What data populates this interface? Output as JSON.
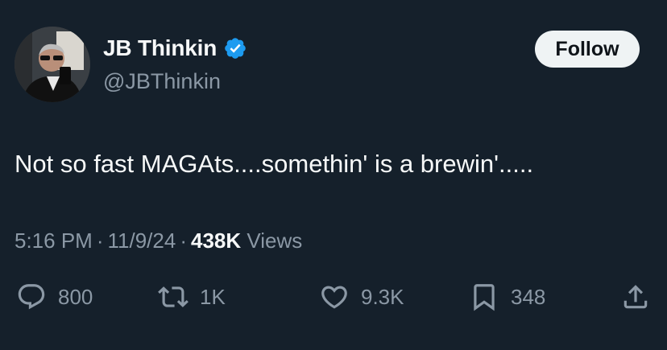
{
  "author": {
    "display_name": "JB Thinkin",
    "handle": "@JBThinkin",
    "verified": true,
    "verified_color": "#1d9bf0"
  },
  "follow_label": "Follow",
  "tweet": {
    "text": "Not so fast MAGAts....somethin' is a brewin'.....",
    "time": "5:16 PM",
    "date": "11/9/24",
    "views_count": "438K",
    "views_label": "Views"
  },
  "actions": {
    "replies": {
      "icon": "reply-icon",
      "count": "800"
    },
    "reposts": {
      "icon": "repost-icon",
      "count": "1K"
    },
    "likes": {
      "icon": "heart-icon",
      "count": "9.3K"
    },
    "bookmarks": {
      "icon": "bookmark-icon",
      "count": "348"
    },
    "share": {
      "icon": "share-icon"
    }
  },
  "colors": {
    "background": "#15202b",
    "text_primary": "#f7f9f9",
    "text_secondary": "#8b98a5",
    "button_bg": "#eff3f4"
  }
}
